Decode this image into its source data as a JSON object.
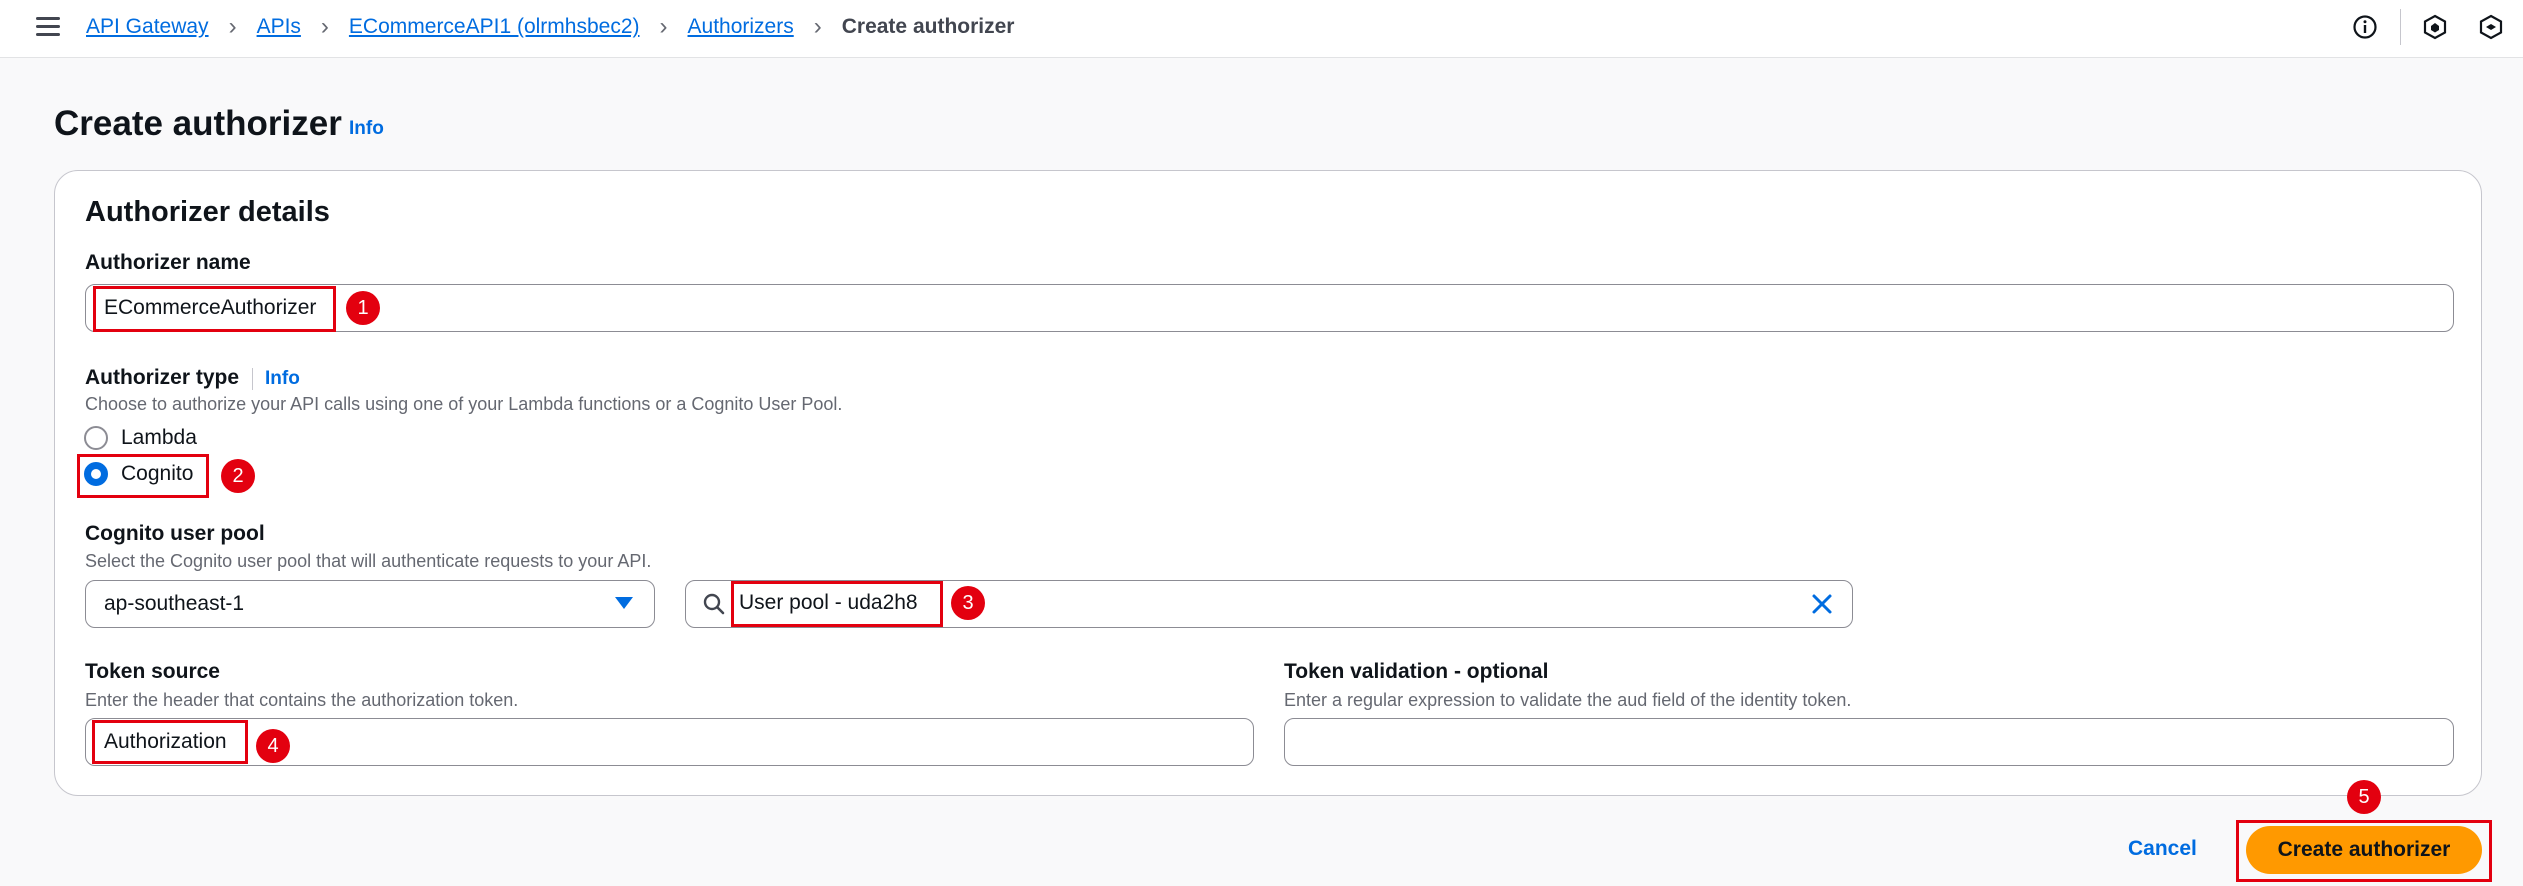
{
  "breadcrumb": {
    "items": [
      "API Gateway",
      "APIs",
      "ECommerceAPI1 (olrmhsbec2)",
      "Authorizers"
    ],
    "current": "Create authorizer"
  },
  "header_icons": [
    "info-circle-icon",
    "notifications-hex-icon",
    "settings-hex-icon"
  ],
  "page": {
    "title": "Create authorizer",
    "info_label": "Info"
  },
  "form": {
    "section_title": "Authorizer details",
    "name": {
      "label": "Authorizer name",
      "value": "ECommerceAuthorizer"
    },
    "type": {
      "label": "Authorizer type",
      "info_label": "Info",
      "description": "Choose to authorize your API calls using one of your Lambda functions or a Cognito User Pool.",
      "options": [
        "Lambda",
        "Cognito"
      ],
      "selected": "Cognito"
    },
    "user_pool": {
      "label": "Cognito user pool",
      "description": "Select the Cognito user pool that will authenticate requests to your API.",
      "region": "ap-southeast-1",
      "pool_value": "User pool - uda2h8"
    },
    "token_source": {
      "label": "Token source",
      "description": "Enter the header that contains the authorization token.",
      "value": "Authorization"
    },
    "token_validation": {
      "label": "Token validation - optional",
      "description": "Enter a regular expression to validate the aud field of the identity token.",
      "value": ""
    }
  },
  "actions": {
    "cancel_label": "Cancel",
    "submit_label": "Create authorizer"
  },
  "annotations": [
    "1",
    "2",
    "3",
    "4",
    "5"
  ],
  "colors": {
    "accent": "#006ce0",
    "primary_button": "#ff9900",
    "annotation_red": "#e3000f"
  }
}
